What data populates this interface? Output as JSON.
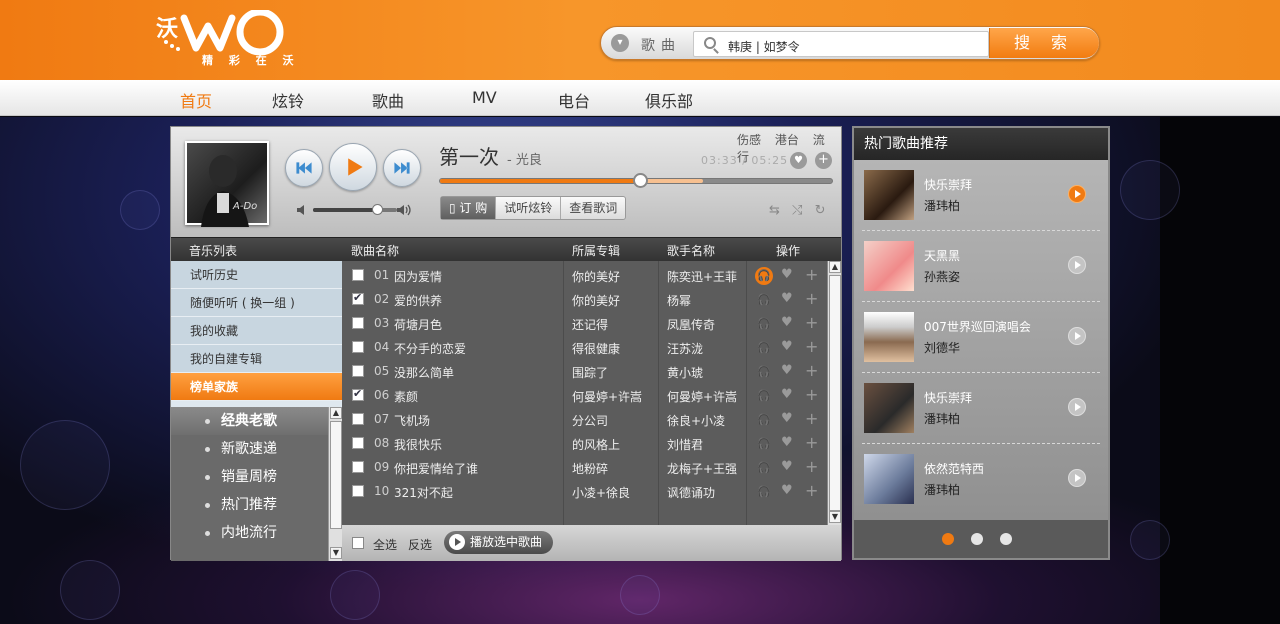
{
  "brand": {
    "logo_text": "沃",
    "slogan": "精 彩 在 沃"
  },
  "search": {
    "category": "歌曲",
    "value": "韩庚 | 如梦令",
    "button": "搜 索"
  },
  "nav": [
    "首页",
    "炫铃",
    "歌曲",
    "MV",
    "电台",
    "俱乐部"
  ],
  "nav_active": "首页",
  "player": {
    "album_text": "A-Do",
    "title": "第一次",
    "artist": "- 光良",
    "tags": [
      "伤感",
      "港台",
      "流行"
    ],
    "time": "03:33 / 05:25",
    "progress": 0.51,
    "buffered": 0.67,
    "volume": 0.76,
    "actions": [
      "订 购",
      "试听炫铃",
      "查看歌词"
    ]
  },
  "columns": {
    "list": "音乐列表",
    "song": "歌曲名称",
    "album": "所属专辑",
    "singer": "歌手名称",
    "ops": "操作"
  },
  "categories": [
    "试听历史",
    "随便听听 ( 换一组 )",
    "我的收藏",
    "我的自建专辑",
    "榜单家族"
  ],
  "active_category": "榜单家族",
  "subcategories": [
    "经典老歌",
    "新歌速递",
    "销量周榜",
    "热门推荐",
    "内地流行"
  ],
  "active_subcategory": "经典老歌",
  "songs": [
    {
      "no": "01",
      "name": "因为爱情",
      "album": "你的美好",
      "singer": "陈奕迅+王菲",
      "checked": false,
      "playing": true
    },
    {
      "no": "02",
      "name": "爱的供养",
      "album": "你的美好",
      "singer": "杨幂",
      "checked": true,
      "playing": false
    },
    {
      "no": "03",
      "name": "荷塘月色",
      "album": "还记得",
      "singer": "凤凰传奇",
      "checked": false,
      "playing": false
    },
    {
      "no": "04",
      "name": "不分手的恋爱",
      "album": "得很健康",
      "singer": "汪苏泷",
      "checked": false,
      "playing": false
    },
    {
      "no": "05",
      "name": "没那么简单",
      "album": "围踪了",
      "singer": "黄小琥",
      "checked": false,
      "playing": false
    },
    {
      "no": "06",
      "name": "素颜",
      "album": "何曼婷+许嵩",
      "singer": "何曼婷+许嵩",
      "checked": true,
      "playing": false
    },
    {
      "no": "07",
      "name": "飞机场",
      "album": "分公司",
      "singer": "徐良+小凌",
      "checked": false,
      "playing": false
    },
    {
      "no": "08",
      "name": "我很快乐",
      "album": "的风格上",
      "singer": "刘惜君",
      "checked": false,
      "playing": false
    },
    {
      "no": "09",
      "name": "你把爱情给了谁",
      "album": "地粉碎",
      "singer": "龙梅子+王强",
      "checked": false,
      "playing": false
    },
    {
      "no": "10",
      "name": "321对不起",
      "album": "小凌+徐良",
      "singer": "讽德诵功",
      "checked": false,
      "playing": false
    }
  ],
  "footer": {
    "select_all": "全选",
    "invert": "反选",
    "play_selected": "播放选中歌曲"
  },
  "hot": {
    "title": "热门歌曲推荐",
    "items": [
      {
        "song": "快乐崇拜",
        "artist": "潘玮柏",
        "playing": true
      },
      {
        "song": "天黑黑",
        "artist": "孙燕姿",
        "playing": false
      },
      {
        "song": "007世界巡回演唱会",
        "artist": "刘德华",
        "playing": false
      },
      {
        "song": "快乐崇拜",
        "artist": "潘玮柏",
        "playing": false
      },
      {
        "song": "依然范特西",
        "artist": "潘玮柏",
        "playing": false
      }
    ],
    "pages": 3,
    "active_page": 0
  },
  "colors": {
    "accent": "#f07a12",
    "header": "#f7962a"
  }
}
